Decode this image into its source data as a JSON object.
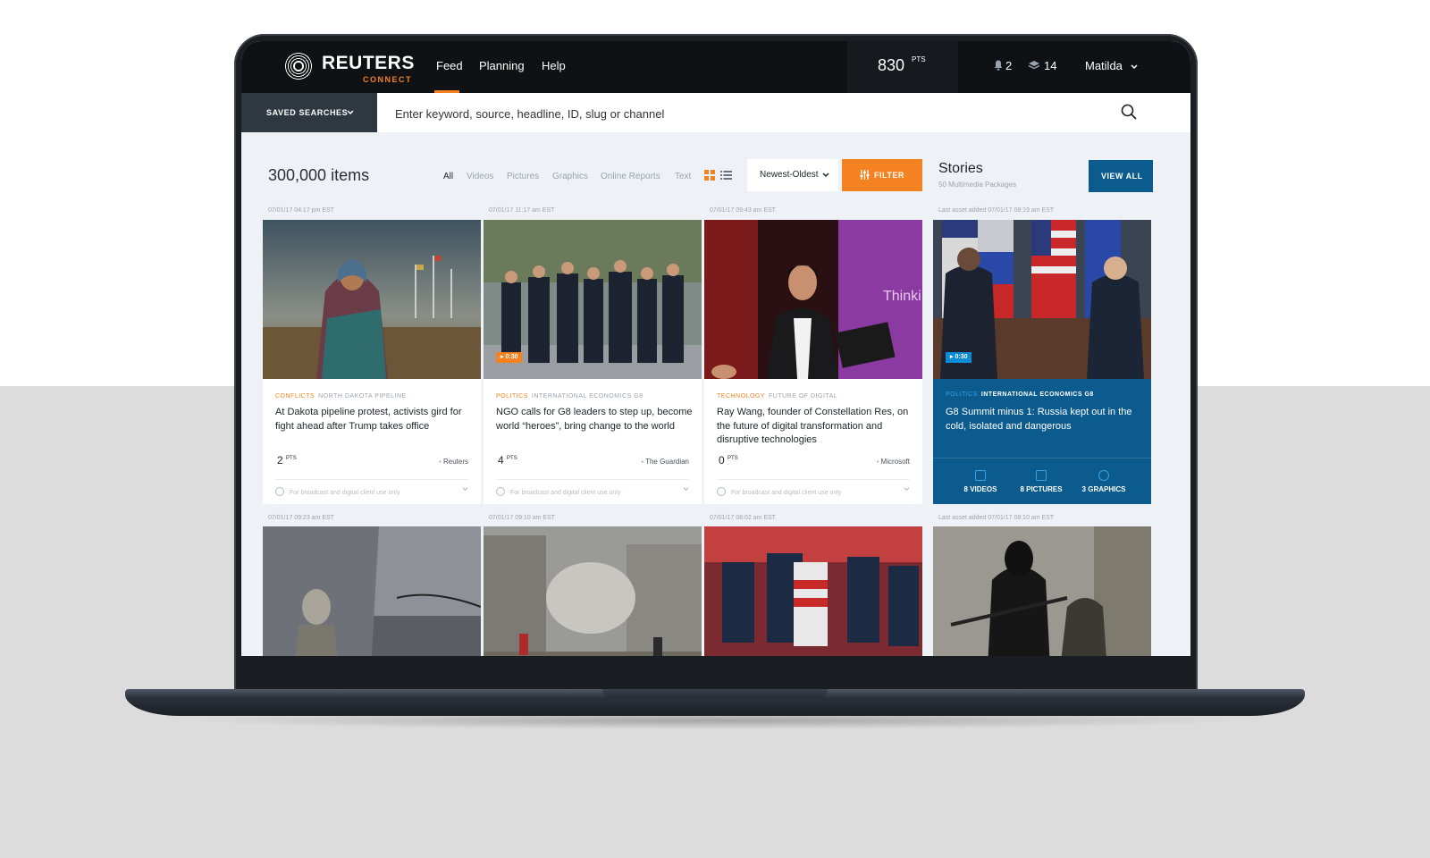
{
  "brand": {
    "name": "REUTERS",
    "sub": "CONNECT"
  },
  "nav": {
    "items": [
      "Feed",
      "Planning",
      "Help"
    ]
  },
  "points": {
    "value": "830",
    "unit": "PTS"
  },
  "notifications": {
    "count": "2"
  },
  "layers": {
    "count": "14"
  },
  "user": {
    "name": "Matilda"
  },
  "search": {
    "saved_label": "SAVED SEARCHES",
    "placeholder": "Enter keyword, source, headline, ID, slug or channel"
  },
  "toolbar": {
    "count": "300,000 items",
    "filters": [
      "All",
      "Videos",
      "Pictures",
      "Graphics",
      "Online Reports",
      "Text"
    ],
    "sort": "Newest-Oldest",
    "filter_label": "FILTER"
  },
  "stories": {
    "title": "Stories",
    "subtitle": "50 Multimedia Packages",
    "view_all": "VIEW ALL"
  },
  "cards": [
    {
      "timestamp": "07/01/17 04:17 pm EST",
      "tag1": "CONFLICTS",
      "tag2": "NORTH DAKOTA PIPELINE",
      "headline": "At Dakota pipeline protest, activists gird for fight ahead after Trump takes office",
      "pts": "2",
      "pts_unit": "PTS",
      "source": "Reuters",
      "license": "For broadcast and digital client use only"
    },
    {
      "timestamp": "07/01/17 11:17 am EST",
      "duration": "0:30",
      "tag1": "POLITICS",
      "tag2": "INTERNATIONAL ECONOMICS G8",
      "headline": "NGO calls for G8 leaders to step up, become world “heroes”, bring change to the world",
      "pts": "4",
      "pts_unit": "PTS",
      "source": "The Guardian",
      "license": "For broadcast and digital client use only"
    },
    {
      "timestamp": "07/01/17 09:43 am EST",
      "tag1": "TECHNOLOGY",
      "tag2": "FUTURE OF DIGITAL",
      "headline": "Ray Wang, founder of Constellation Res, on the future of digital transformation and disruptive technologies",
      "pts": "0",
      "pts_unit": "PTS",
      "source": "Microsoft",
      "license": "For broadcast and digital client use only"
    }
  ],
  "story_card": {
    "timestamp": "Last asset added 07/01/17 08:19 am EST",
    "duration": "0:30",
    "tag1": "POLITICS",
    "tag2": "INTERNATIONAL ECONOMICS G8",
    "headline": "G8 Summit minus 1: Russia kept out in the cold, isolated and dangerous",
    "stats": [
      "8 VIDEOS",
      "8 PICTURES",
      "3 GRAPHICS"
    ]
  },
  "row2": {
    "timestamps": [
      "07/01/17 09:23 am EST",
      "07/01/17 09:10 am EST",
      "07/01/17 08:02 am EST",
      "Last asset added 07/01/17 08:10 am EST"
    ]
  },
  "colors": {
    "accent": "#f58220",
    "brand_blue": "#0c5b8f",
    "nav_bg": "#0f1115"
  }
}
